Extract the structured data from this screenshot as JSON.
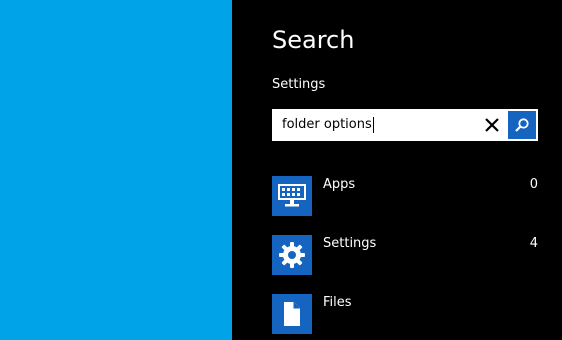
{
  "charm": {
    "title": "Search",
    "scope": "Settings",
    "search": {
      "value": "folder options"
    },
    "results": [
      {
        "label": "Apps",
        "count": "0",
        "icon": "apps-icon"
      },
      {
        "label": "Settings",
        "count": "4",
        "icon": "gear-icon"
      },
      {
        "label": "Files",
        "count": "",
        "icon": "file-icon"
      }
    ]
  },
  "colors": {
    "desktop": "#00a3e8",
    "charm_background": "#000000",
    "tile_accent": "#1565c0",
    "text": "#ffffff"
  }
}
